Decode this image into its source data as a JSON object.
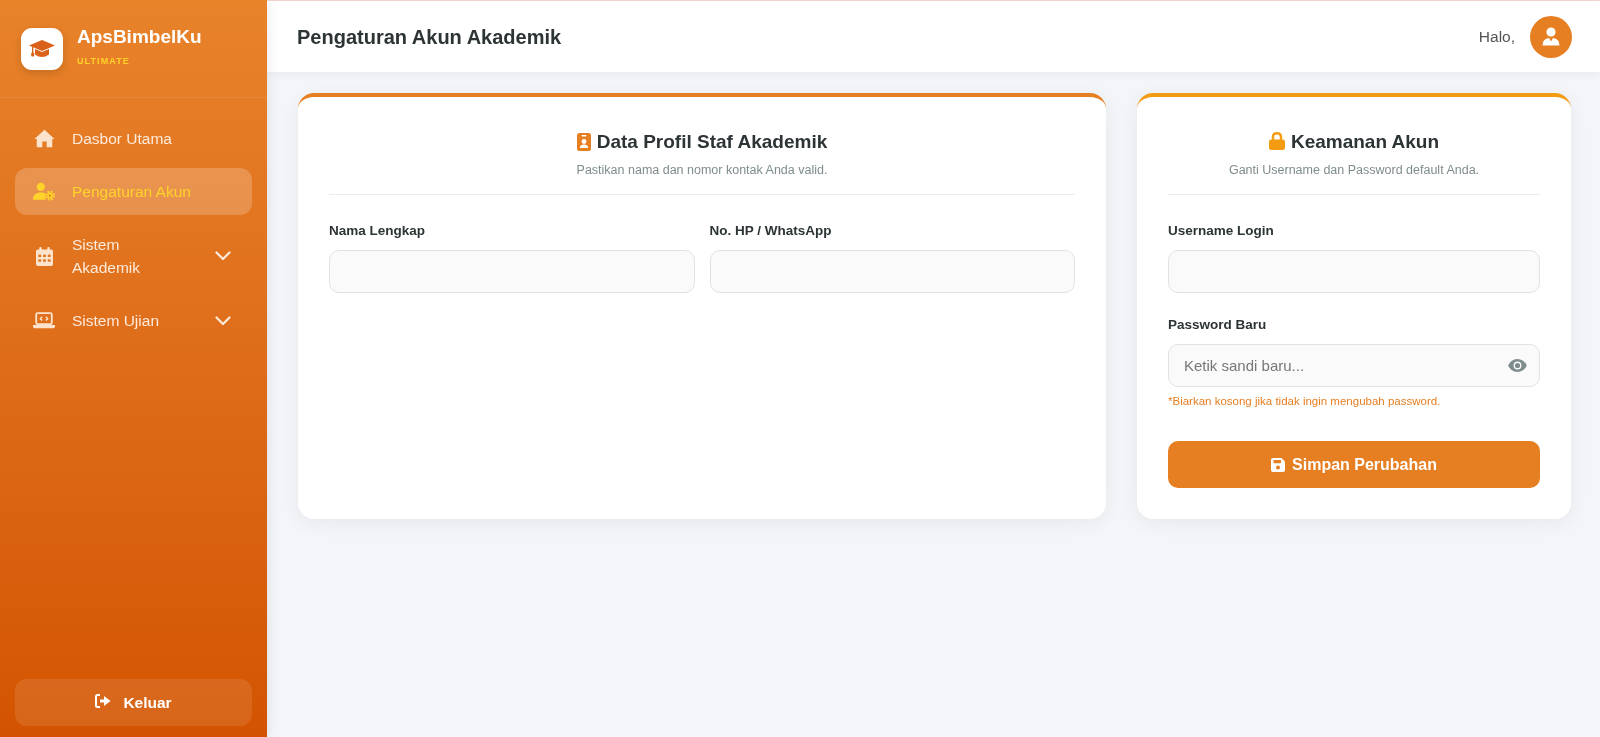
{
  "sidebar": {
    "brand": {
      "name": "ApsBimbelKu",
      "tier": "ULTIMATE"
    },
    "items": [
      {
        "label": "Dasbor Utama",
        "kind": "link",
        "selected": false
      },
      {
        "label": "Pengaturan Akun",
        "kind": "link",
        "selected": true
      },
      {
        "label": "Sistem Akademik",
        "kind": "group",
        "selected": false,
        "expanded": false
      },
      {
        "label": "Sistem Ujian",
        "kind": "group",
        "selected": false,
        "expanded": false
      }
    ],
    "logout_button": "Keluar"
  },
  "header": {
    "title": "Pengaturan Akun Akademik",
    "greeting": "Halo,"
  },
  "profile_card": {
    "title": "Data Profil Staf Akademik",
    "subtitle": "Pastikan nama dan nomor kontak Anda valid.",
    "fields": [
      {
        "label": "Nama Lengkap",
        "kind": "text"
      },
      {
        "label": "No. HP / WhatsApp",
        "kind": "text"
      }
    ]
  },
  "security_card": {
    "title": "Keamanan Akun",
    "subtitle": "Ganti Username dan Password default Anda.",
    "fields": [
      {
        "label": "Username Login",
        "kind": "text"
      },
      {
        "label": "Password Baru",
        "kind": "password",
        "placeholder": "Ketik sandi baru...",
        "hint": "*Biarkan kosong jika tidak ingin mengubah password."
      }
    ],
    "save_button": "Simpan Perubahan"
  }
}
